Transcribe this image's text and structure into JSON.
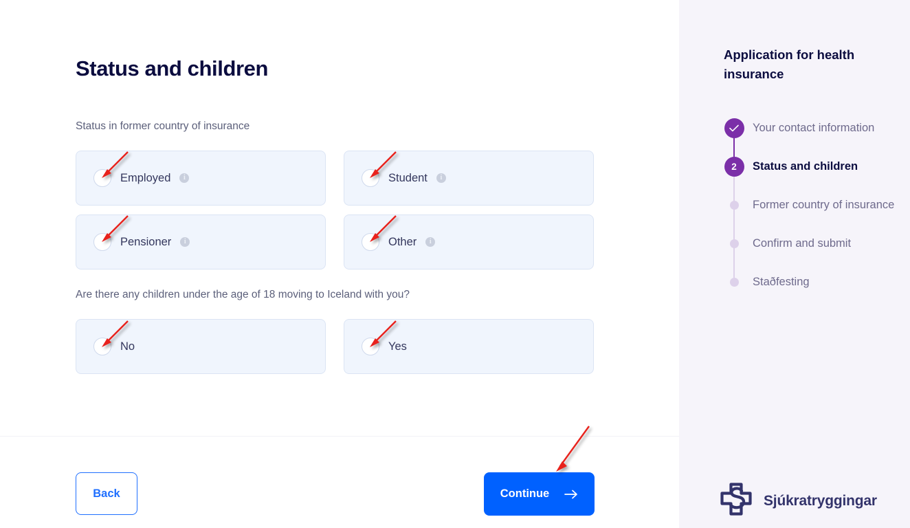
{
  "main": {
    "page_title": "Status and children",
    "status_label": "Status in former country of insurance",
    "children_label": "Are there any children under the age of 18 moving to Iceland with you?",
    "status_options": [
      {
        "label": "Employed",
        "has_info": true
      },
      {
        "label": "Student",
        "has_info": true
      },
      {
        "label": "Pensioner",
        "has_info": true
      },
      {
        "label": "Other",
        "has_info": true
      }
    ],
    "children_options": [
      {
        "label": "No",
        "has_info": false
      },
      {
        "label": "Yes",
        "has_info": false
      }
    ],
    "back_label": "Back",
    "continue_label": "Continue"
  },
  "sidebar": {
    "title": "Application for health insurance",
    "steps": [
      {
        "label": "Your contact information",
        "state": "done",
        "marker": "check"
      },
      {
        "label": "Status and children",
        "state": "active",
        "marker": "2"
      },
      {
        "label": "Former country of insurance",
        "state": "todo",
        "marker": ""
      },
      {
        "label": "Confirm and submit",
        "state": "todo",
        "marker": ""
      },
      {
        "label": "Staðfesting",
        "state": "todo",
        "marker": ""
      }
    ],
    "logo_text": "Sjúkratryggingar"
  },
  "colors": {
    "accent_blue": "#0061ff",
    "purple": "#7b2fa8",
    "purple_light": "#ddd1ea",
    "navy": "#0b0c3f",
    "card_bg": "#f0f5fd",
    "card_border": "#dbe4f4",
    "sidebar_bg": "#f6f4fa",
    "logo_navy": "#33336b",
    "annotation_red": "#e8201a"
  }
}
